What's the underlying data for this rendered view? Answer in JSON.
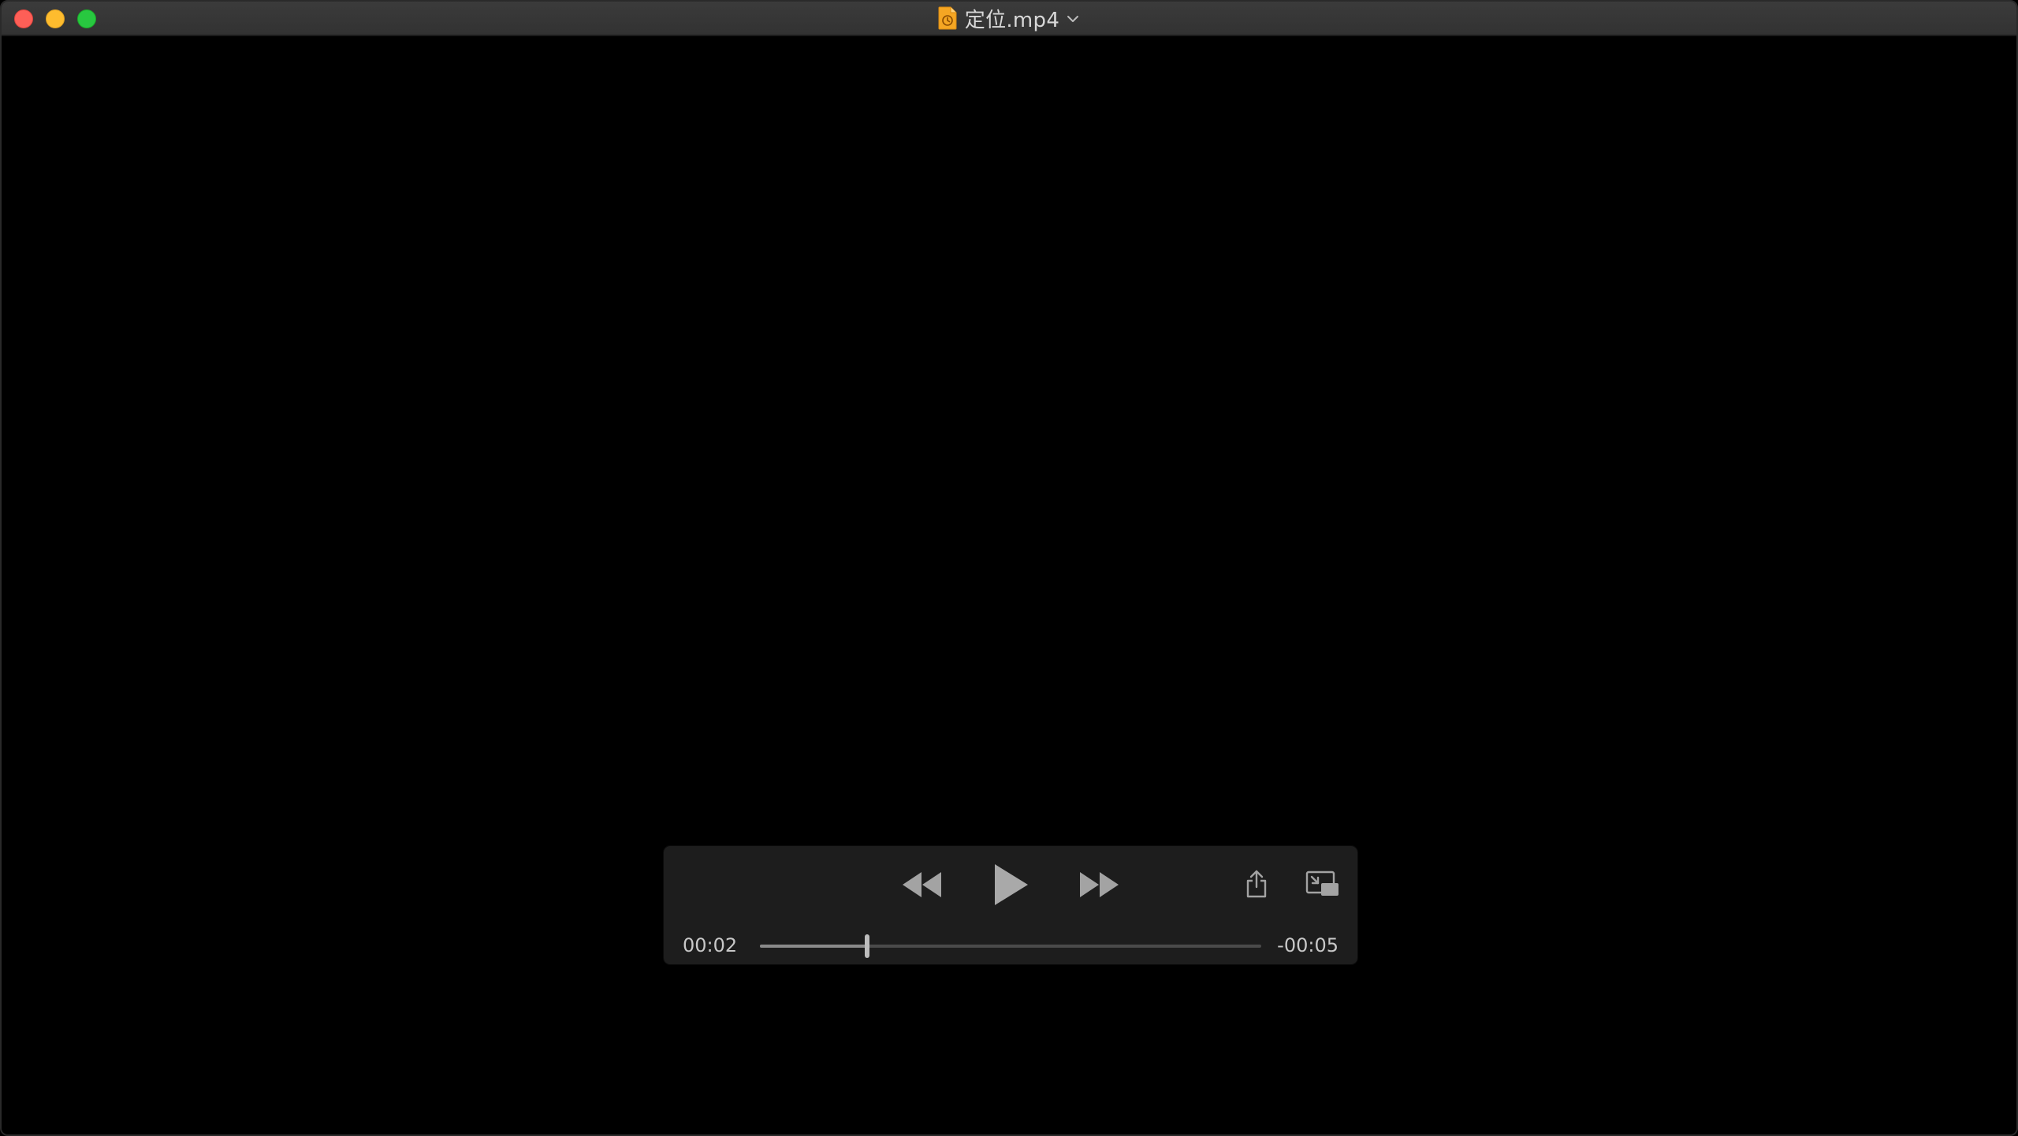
{
  "window": {
    "title": "定位.mp4",
    "title_icon": "video-file-icon"
  },
  "colors": {
    "close": "#fe5f57",
    "minimize": "#febc2e",
    "maximize": "#28c840",
    "file_icon": "#f5a623"
  },
  "controls": {
    "rewind_icon": "rewind-icon",
    "play_icon": "play-icon",
    "fast_forward_icon": "fast-forward-icon",
    "share_icon": "share-icon",
    "pip_icon": "picture-in-picture-icon"
  },
  "playback": {
    "elapsed": "00:02",
    "remaining": "-00:05",
    "progress": 0.214
  }
}
